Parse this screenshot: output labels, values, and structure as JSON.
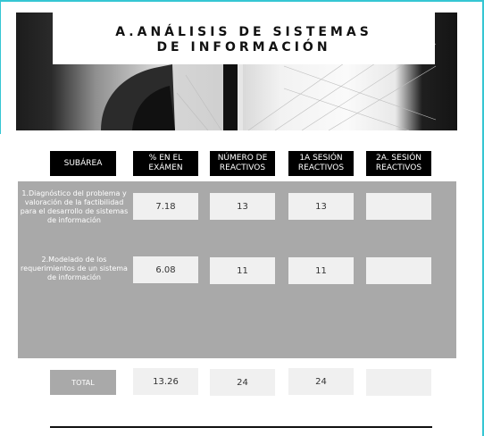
{
  "title": {
    "line1": "A.ANÁLISIS DE SISTEMAS",
    "line2": "DE INFORMACIÓN"
  },
  "headers": {
    "subarea": "SUBÁREA",
    "pct": "% EN EL EXÁMEN",
    "num": "NÚMERO DE REACTIVOS",
    "s1": "1A SESIÓN REACTIVOS",
    "s2": "2A. SESIÓN REACTIVOS"
  },
  "rows": [
    {
      "subarea": "1.Diagnóstico del problema y valoración de la factibilidad para el desarrollo de sistemas de información",
      "pct": "7.18",
      "num": "13",
      "s1": "13",
      "s2": ""
    },
    {
      "subarea": "2.Modelado de los requerimientos de un sistema de información",
      "pct": "6.08",
      "num": "11",
      "s1": "11",
      "s2": ""
    }
  ],
  "total": {
    "label": "TOTAL",
    "pct": "13.26",
    "num": "24",
    "s1": "24",
    "s2": ""
  },
  "colors": {
    "accent": "#35c6d3",
    "header_bg": "#000000",
    "panel_bg": "#a9a9a9",
    "cell_bg": "#f0f0f0"
  }
}
